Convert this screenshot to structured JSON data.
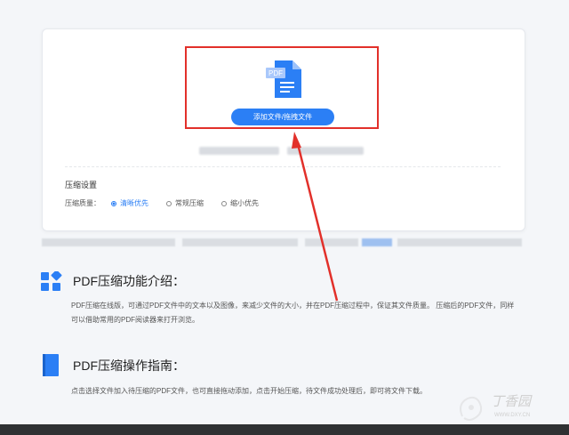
{
  "upload": {
    "file_type_badge": "PDF",
    "button_label": "添加文件/拖拽文件"
  },
  "settings": {
    "title": "压缩设置",
    "quality_label": "压缩质量：",
    "options": [
      {
        "label": "清晰优先",
        "selected": true
      },
      {
        "label": "常规压缩",
        "selected": false
      },
      {
        "label": "缩小优先",
        "selected": false
      }
    ]
  },
  "intro": {
    "title": "PDF压缩功能介绍：",
    "body": "PDF压缩在线版，可通过PDF文件中的文本以及图像，来减少文件的大小，并在PDF压缩过程中，保证其文件质量。 压缩后的PDF文件，同样可以借助常用的PDF阅读器来打开浏览。"
  },
  "guide": {
    "title": "PDF压缩操作指南：",
    "body": "点击选择文件加入待压缩的PDF文件，也可直接拖动添加，点击开始压缩，待文件成功处理后，即可将文件下载。"
  },
  "watermark": {
    "text": "丁香园",
    "url": "WWW.DXY.CN"
  },
  "colors": {
    "accent": "#2b7ff5",
    "highlight_border": "#e2302a",
    "arrow": "#e2302a"
  }
}
